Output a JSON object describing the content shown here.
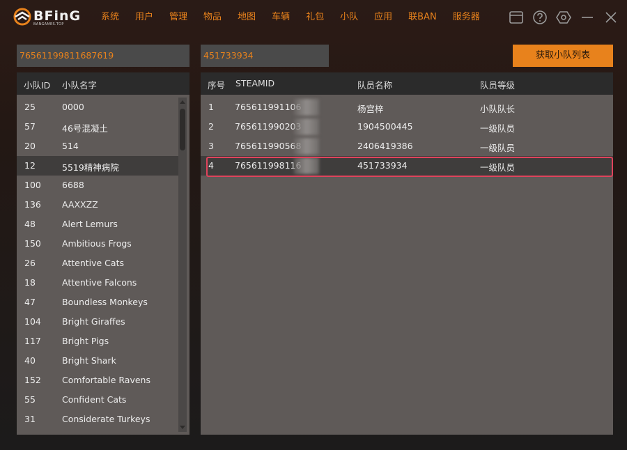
{
  "app": {
    "logo_text": "BFinG",
    "logo_sub": "BANGAMES.TOP",
    "accent": "#e8821c",
    "highlight": "#e0435c"
  },
  "nav": [
    "系统",
    "用户",
    "管理",
    "物品",
    "地图",
    "车辆",
    "礼包",
    "小队",
    "应用",
    "联BAN",
    "服务器"
  ],
  "window_icons": [
    "window-icon",
    "help-icon",
    "settings-icon",
    "minimize-icon",
    "close-icon"
  ],
  "inputs": {
    "steam_id": "76561199811687619",
    "team_id": "451733934"
  },
  "fetch_button": "获取小队列表",
  "team_table": {
    "headers": {
      "id": "小队ID",
      "name": "小队名字"
    },
    "rows": [
      {
        "id": "25",
        "name": "0000"
      },
      {
        "id": "57",
        "name": "46号混凝土"
      },
      {
        "id": "20",
        "name": "514"
      },
      {
        "id": "12",
        "name": "5519精神病院",
        "selected": true
      },
      {
        "id": "100",
        "name": "6688"
      },
      {
        "id": "136",
        "name": "AAXXZZ"
      },
      {
        "id": "48",
        "name": "Alert Lemurs"
      },
      {
        "id": "150",
        "name": "Ambitious Frogs"
      },
      {
        "id": "26",
        "name": "Attentive Cats"
      },
      {
        "id": "18",
        "name": "Attentive Falcons"
      },
      {
        "id": "47",
        "name": "Boundless Monkeys"
      },
      {
        "id": "104",
        "name": "Bright Giraffes"
      },
      {
        "id": "117",
        "name": "Bright Pigs"
      },
      {
        "id": "40",
        "name": "Bright Shark"
      },
      {
        "id": "152",
        "name": "Comfortable Ravens"
      },
      {
        "id": "55",
        "name": "Confident Cats"
      },
      {
        "id": "31",
        "name": "Considerate Turkeys"
      }
    ]
  },
  "member_table": {
    "headers": {
      "seq": "序号",
      "steamid": "STEAMID",
      "name": "队员名称",
      "level": "队员等级"
    },
    "rows": [
      {
        "seq": "1",
        "steamid": "765611991106",
        "name": "杨宫梓",
        "level": "小队队长"
      },
      {
        "seq": "2",
        "steamid": "765611990203",
        "name": "1904500445",
        "level": "一级队员"
      },
      {
        "seq": "3",
        "steamid": "765611990568",
        "name": "2406419386",
        "level": "一级队员"
      },
      {
        "seq": "4",
        "steamid": "765611998116",
        "name": "451733934",
        "level": "一级队员",
        "selected": true
      }
    ]
  }
}
